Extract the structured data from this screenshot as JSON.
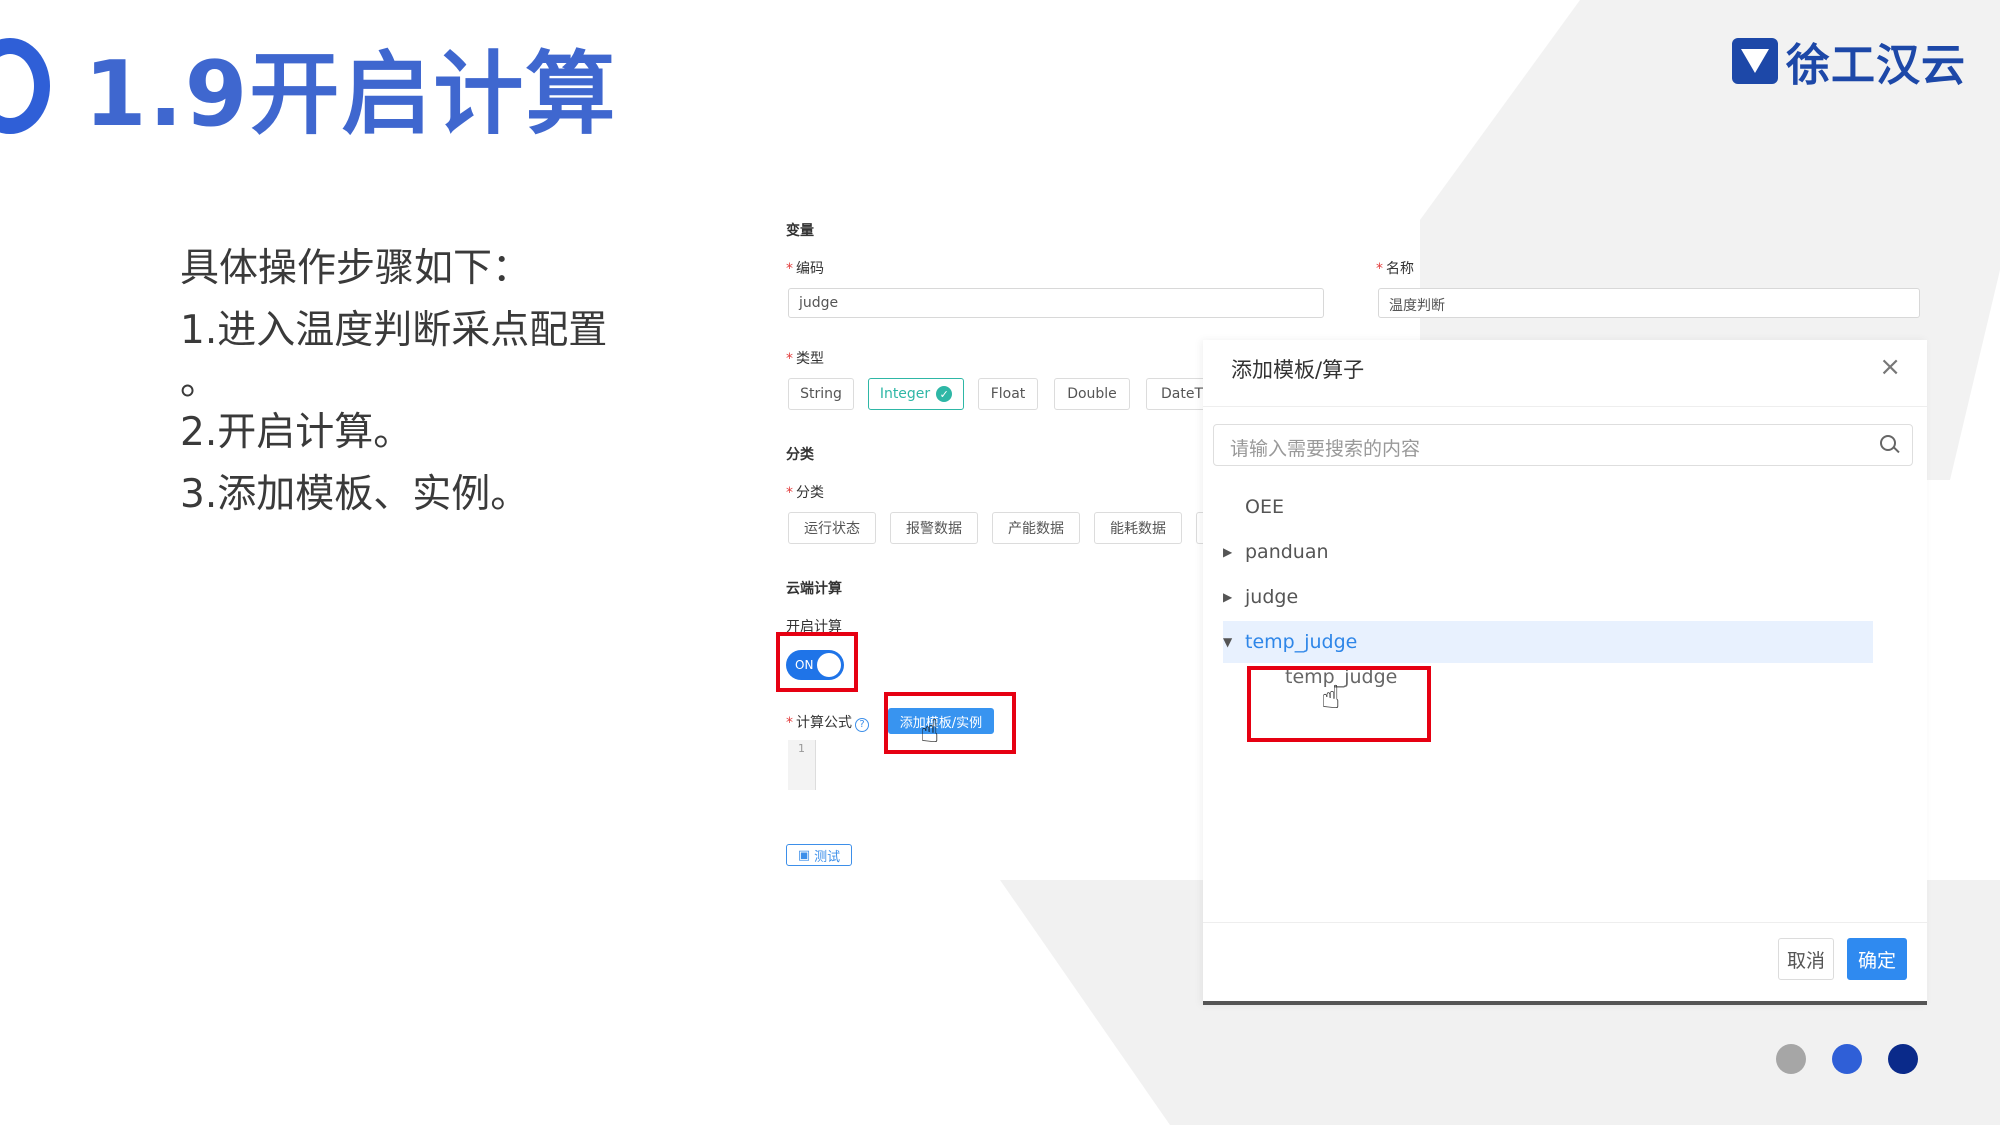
{
  "slide": {
    "title": "1.9开启计算",
    "logo_text": "徐工汉云",
    "steps": [
      "具体操作步骤如下：",
      "1.进入温度判断采点配置",
      "。",
      "2.开启计算。",
      "3.添加模板、实例。"
    ]
  },
  "form": {
    "section_variable": "变量",
    "code_label": "编码",
    "code_value": "judge",
    "name_label": "名称",
    "name_value": "温度判断",
    "type_label": "类型",
    "types": [
      "String",
      "Integer",
      "Float",
      "Double",
      "DateTi"
    ],
    "selected_type": "Integer",
    "section_category": "分类",
    "category_label": "分类",
    "categories": [
      "运行状态",
      "报警数据",
      "产能数据",
      "能耗数据"
    ],
    "section_cloud": "云端计算",
    "enable_calc_label": "开启计算",
    "toggle_text": "ON",
    "formula_label": "计算公式",
    "add_template_button": "添加模板/实例",
    "editor_line": "1",
    "test_button": "测试"
  },
  "dialog": {
    "title": "添加模板/算子",
    "close_glyph": "×",
    "search_placeholder": "请输入需要搜索的内容",
    "tree": [
      {
        "label": "OEE",
        "caret": ""
      },
      {
        "label": "panduan",
        "caret": "▶"
      },
      {
        "label": "judge",
        "caret": "▶"
      },
      {
        "label": "temp_judge",
        "caret": "▼"
      }
    ],
    "tree_child": "temp_judge",
    "cancel": "取消",
    "ok": "确定"
  },
  "colors": {
    "title_blue": "#3f67cf",
    "accent_teal": "#2eb7a6",
    "primary_blue": "#2f8af0",
    "highlight_red": "#e60012",
    "dots": [
      "#a6a6a6",
      "#2f5fd7",
      "#0a2a8a"
    ]
  }
}
